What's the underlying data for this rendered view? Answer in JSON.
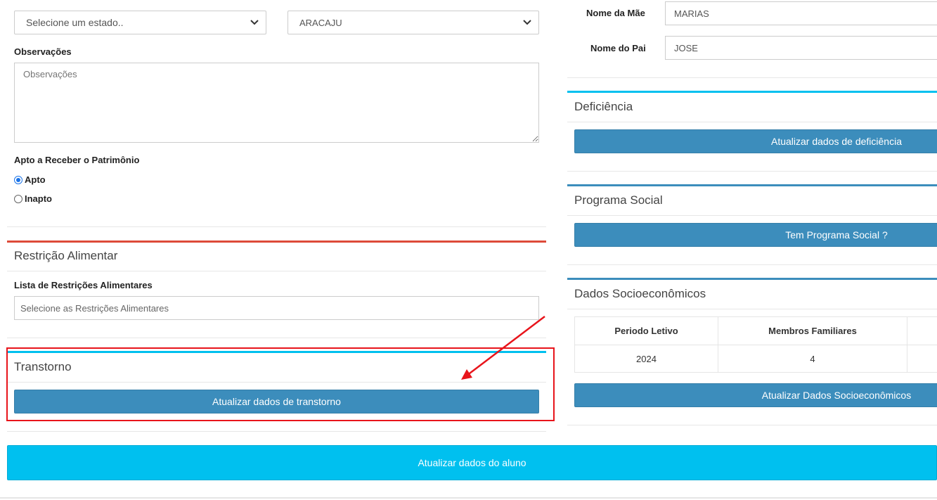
{
  "form": {
    "estado_select": "Selecione um estado..",
    "cidade_select": "ARACAJU",
    "observacoes_label": "Observações",
    "observacoes_placeholder": "Observações",
    "patrimonio_label": "Apto a Receber o Patrimônio",
    "radio_apto": "Apto",
    "radio_inapto": "Inapto",
    "apto_selected": true
  },
  "parents": {
    "mae_label": "Nome da Mãe",
    "mae_value": "MARIAS",
    "pai_label": "Nome do Pai",
    "pai_value": "JOSE"
  },
  "restricao": {
    "title": "Restrição Alimentar",
    "list_label": "Lista de Restrições Alimentares",
    "placeholder": "Selecione as Restrições Alimentares"
  },
  "transtorno": {
    "title": "Transtorno",
    "button": "Atualizar dados de transtorno"
  },
  "deficiencia": {
    "title": "Deficiência",
    "button": "Atualizar dados de deficiência"
  },
  "programa_social": {
    "title": "Programa Social",
    "button": "Tem Programa Social ?"
  },
  "socioeconomicos": {
    "title": "Dados Socioeconômicos",
    "columns": [
      "Periodo Letivo",
      "Membros Familiares"
    ],
    "rows": [
      [
        "2024",
        "4"
      ]
    ],
    "button": "Atualizar Dados Socioeconômicos"
  },
  "footer": {
    "button": "Atualizar dados do aluno"
  },
  "colors": {
    "primary": "#3c8dbc",
    "info": "#00c0ef",
    "danger": "#dd4b39",
    "highlight_annotation": "#e8141b"
  }
}
